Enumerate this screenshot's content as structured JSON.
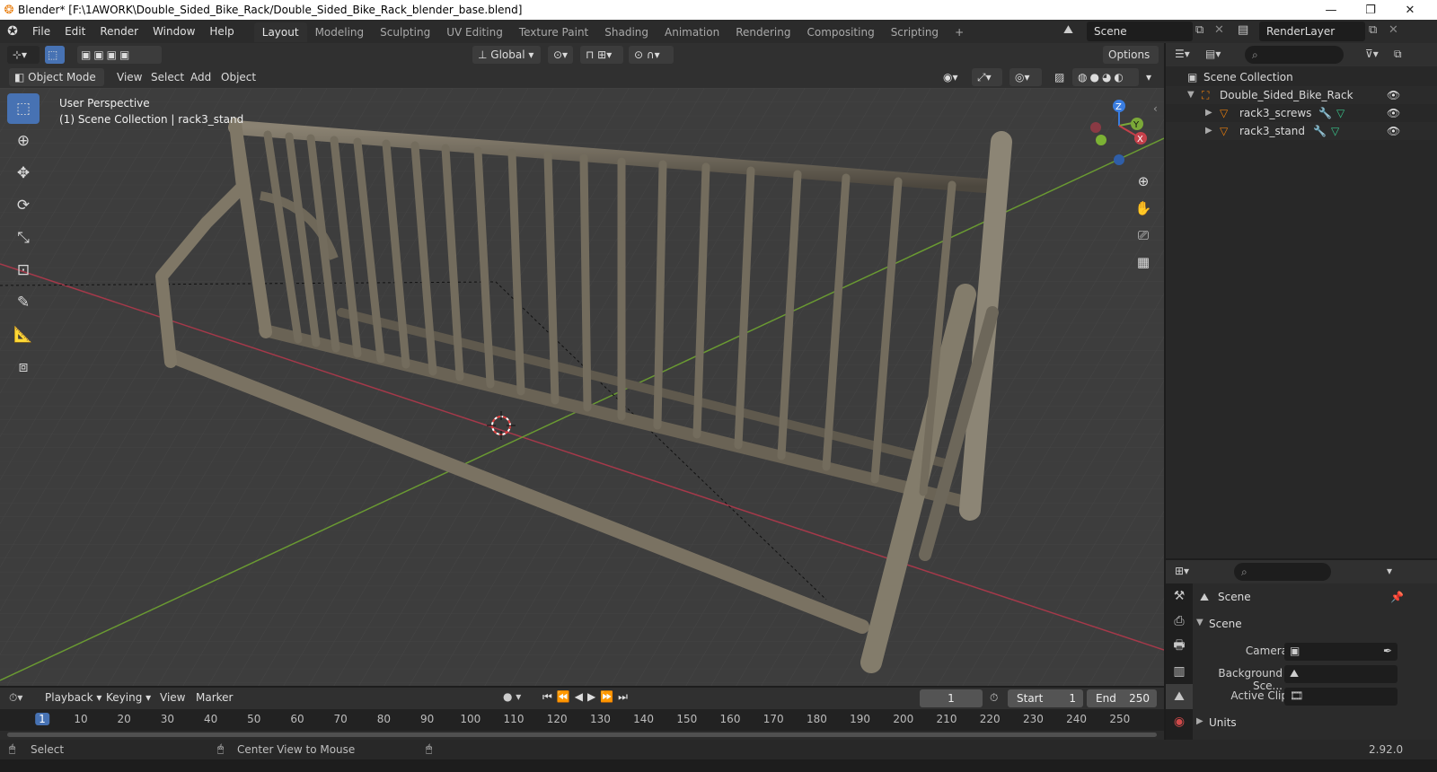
{
  "window": {
    "title": "Blender* [F:\\1AWORK\\Double_Sided_Bike_Rack/Double_Sided_Bike_Rack_blender_base.blend]",
    "controls": [
      "—",
      "❐",
      "✕"
    ]
  },
  "menubar": {
    "items": [
      "File",
      "Edit",
      "Render",
      "Window",
      "Help"
    ],
    "workspaces": [
      "Layout",
      "Modeling",
      "Sculpting",
      "UV Editing",
      "Texture Paint",
      "Shading",
      "Animation",
      "Rendering",
      "Compositing",
      "Scripting"
    ],
    "active_workspace": "Layout",
    "add_tab": "+",
    "scene": "Scene",
    "render_layer": "RenderLayer"
  },
  "viewport_header": {
    "orientation": "Global",
    "options_label": "Options",
    "mode": "Object Mode",
    "menus": [
      "View",
      "Select",
      "Add",
      "Object"
    ]
  },
  "viewport": {
    "perspective": "User Perspective",
    "collection_info": "(1) Scene Collection | rack3_stand",
    "gizmo_axes": [
      "Z",
      "Y",
      "X"
    ]
  },
  "toolbox": {
    "tools": [
      "select-box",
      "cursor",
      "move",
      "rotate",
      "scale",
      "transform",
      "annotate",
      "measure",
      "add-cube"
    ],
    "active": "select-box"
  },
  "outliner": {
    "root": "Scene Collection",
    "collection": "Double_Sided_Bike_Rack",
    "objects": [
      "rack3_screws",
      "rack3_stand"
    ]
  },
  "properties": {
    "title": "Scene",
    "panel": "Scene",
    "fields": [
      {
        "label": "Camera",
        "value": ""
      },
      {
        "label": "Background Sce...",
        "value": ""
      },
      {
        "label": "Active Clip",
        "value": ""
      }
    ],
    "subpanel": "Units"
  },
  "timeline": {
    "menus": [
      "Playback",
      "Keying",
      "View",
      "Marker"
    ],
    "current_frame": "1",
    "start_label": "Start",
    "start": "1",
    "end_label": "End",
    "end": "250",
    "ruler": [
      "1",
      "10",
      "20",
      "30",
      "40",
      "50",
      "60",
      "70",
      "80",
      "90",
      "100",
      "110",
      "120",
      "130",
      "140",
      "150",
      "160",
      "170",
      "180",
      "190",
      "200",
      "210",
      "220",
      "230",
      "240",
      "250"
    ]
  },
  "statusbar": {
    "left": "Select",
    "middle": "Center View to Mouse",
    "version": "2.92.0"
  },
  "colors": {
    "accent": "#4772b3",
    "x_axis": "#c4404a",
    "y_axis": "#7ba838",
    "z_axis": "#3a7de0",
    "object_orange": "#e87d0d"
  }
}
